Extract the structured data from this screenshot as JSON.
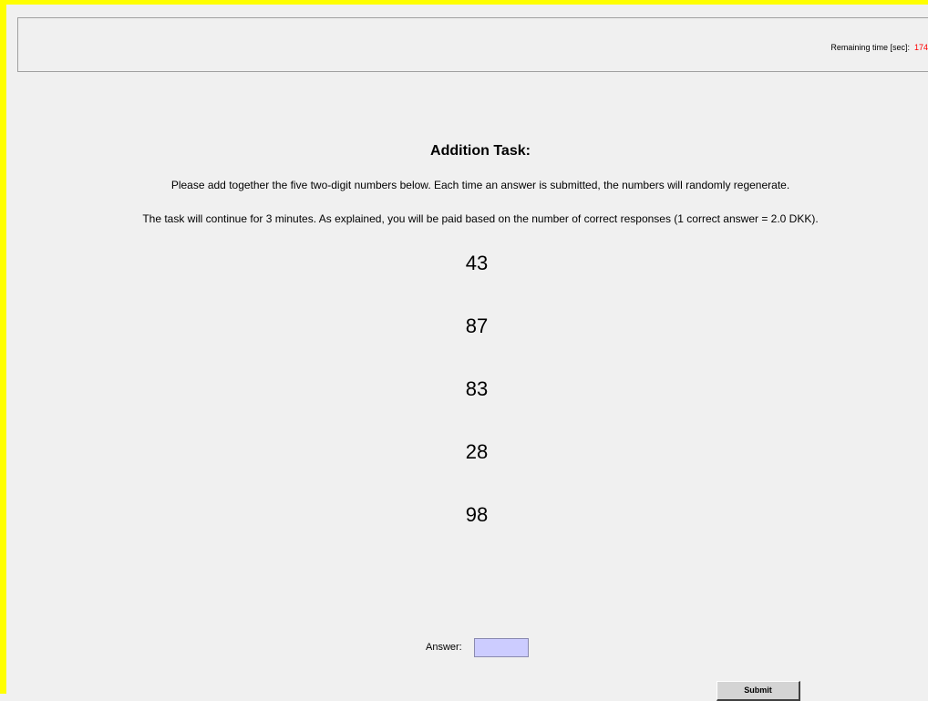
{
  "header": {
    "timer_label": "Remaining time [sec]:",
    "timer_value": "174"
  },
  "task": {
    "title": "Addition Task:",
    "instruction_1": "Please add together the five two-digit numbers below. Each time an answer is submitted, the numbers will randomly regenerate.",
    "instruction_2": "The task will continue for 3 minutes.  As explained, you will be paid based on the number of correct responses (1 correct answer = 2.0 DKK).",
    "numbers": [
      "43",
      "87",
      "83",
      "28",
      "98"
    ]
  },
  "form": {
    "answer_label": "Answer:",
    "answer_value": "",
    "submit_label": "Submit"
  },
  "colors": {
    "frame_border": "#ffff00",
    "timer_value": "#ff0000",
    "input_background": "#ccccff",
    "background": "#f0f0f0"
  }
}
